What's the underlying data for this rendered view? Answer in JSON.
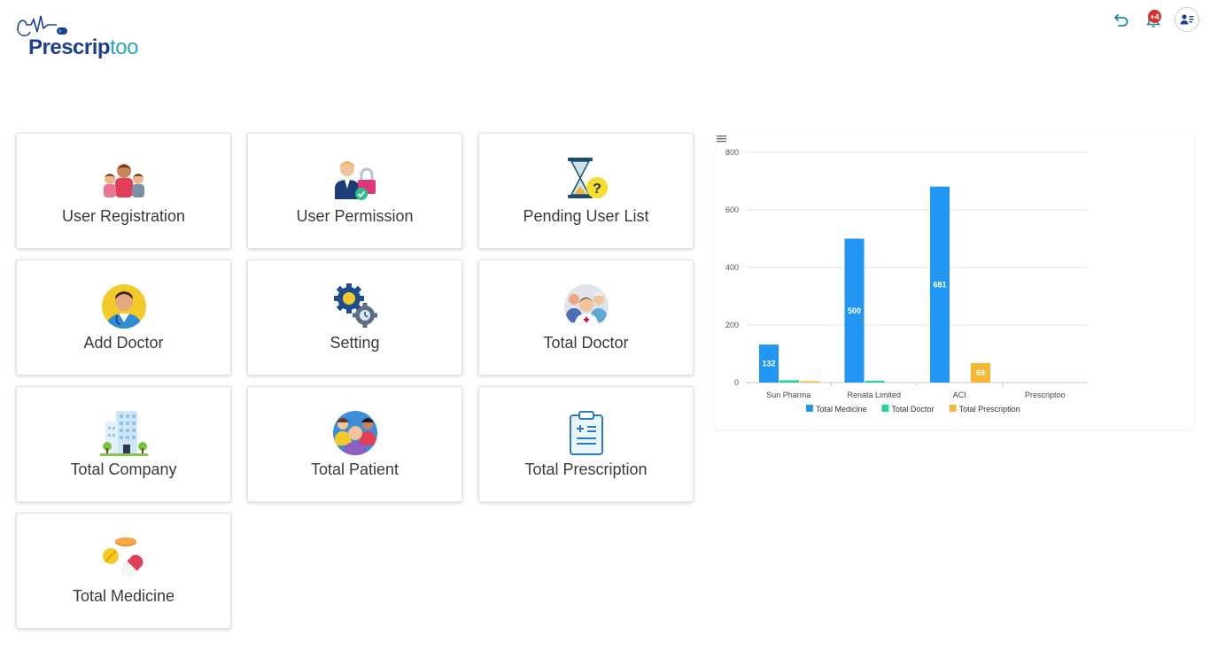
{
  "app": {
    "logo_primary": "Prescrip",
    "logo_secondary": "too",
    "brand_color": "#1c3f94",
    "accent_color": "#2aa6b8"
  },
  "header": {
    "notification_count": "+4",
    "back_icon": "undo-icon",
    "bell_icon": "bell-icon",
    "profile_icon": "user-card-icon"
  },
  "cards": [
    {
      "label": "User Registration",
      "icon": "family-users-icon"
    },
    {
      "label": "User Permission",
      "icon": "user-lock-icon"
    },
    {
      "label": "Pending User List",
      "icon": "hourglass-question-icon"
    },
    {
      "label": "Add Doctor",
      "icon": "doctor-avatar-icon"
    },
    {
      "label": "Setting",
      "icon": "gears-icon"
    },
    {
      "label": "Total Doctor",
      "icon": "medical-team-icon"
    },
    {
      "label": "Total Company",
      "icon": "office-building-icon"
    },
    {
      "label": "Total Patient",
      "icon": "patients-group-icon"
    },
    {
      "label": "Total Prescription",
      "icon": "clipboard-prescription-icon"
    },
    {
      "label": "Total Medicine",
      "icon": "pills-icon"
    }
  ],
  "chart_data": {
    "type": "bar",
    "categories": [
      "Sun Pharma",
      "Renata Limited",
      "ACI",
      "Prescriptoo"
    ],
    "series": [
      {
        "name": "Total Medicine",
        "values": [
          132,
          500,
          681,
          0
        ],
        "color": "#2196f3"
      },
      {
        "name": "Total Doctor",
        "values": [
          8,
          6,
          0,
          0
        ],
        "color": "#1ed695"
      },
      {
        "name": "Total Prescription",
        "values": [
          4,
          0,
          68,
          0
        ],
        "color": "#f7b733"
      }
    ],
    "data_labels": [
      [
        "132",
        "",
        ""
      ],
      [
        "500",
        "",
        ""
      ],
      [
        "681",
        "",
        "68"
      ],
      [
        "",
        "",
        ""
      ]
    ],
    "y_ticks": [
      0,
      200,
      400,
      600,
      800
    ],
    "ylim": [
      0,
      800
    ],
    "grid": true,
    "legend": "bottom-center",
    "title": "",
    "xlabel": "",
    "ylabel": ""
  }
}
